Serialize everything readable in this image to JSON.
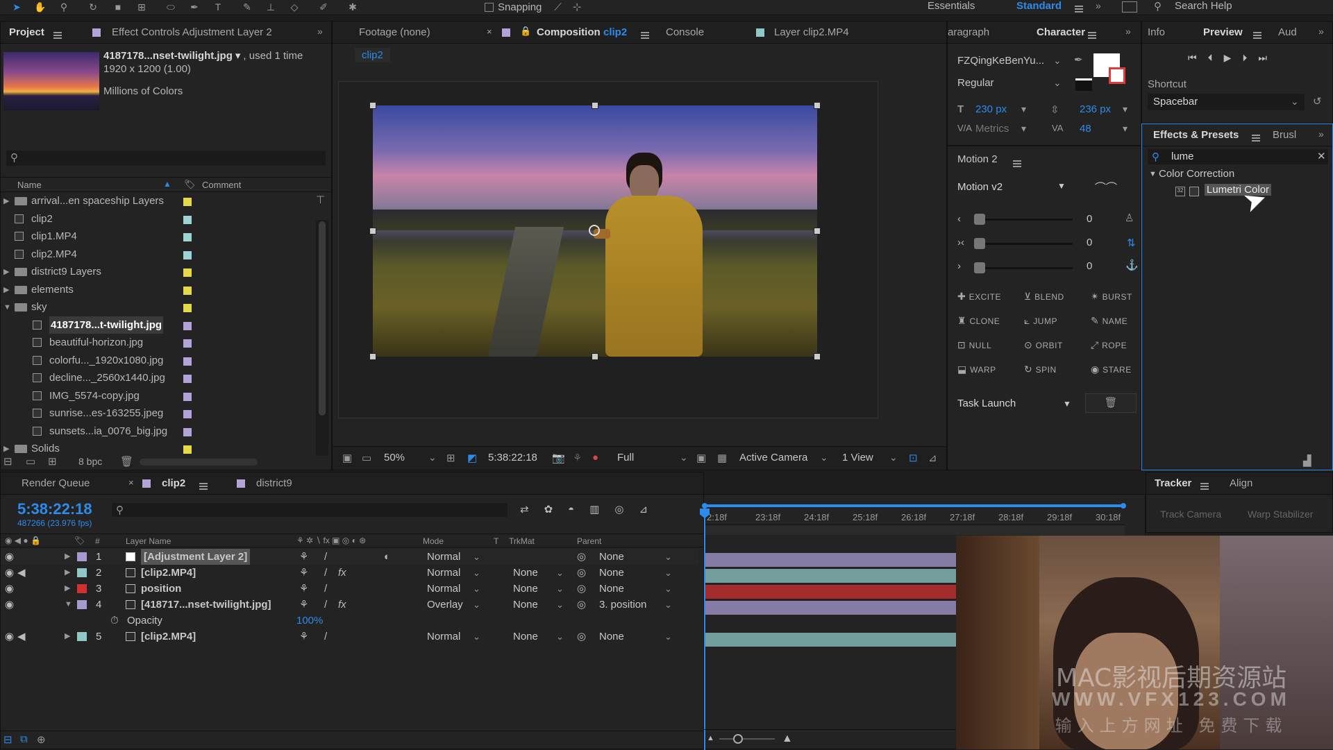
{
  "topbar": {
    "snapping": "Snapping",
    "workspaces": [
      "Essentials",
      "Standard"
    ],
    "search_placeholder": "Search Help"
  },
  "project": {
    "tab": "Project",
    "effect_controls_tab": "Effect Controls Adjustment Layer 2",
    "thumb_name": "4187178...nset-twilight.jpg",
    "used": ", used 1 time",
    "dims": "1920 x 1200 (1.00)",
    "colors": "Millions of Colors",
    "col_name": "Name",
    "col_comment": "Comment",
    "bpc": "8 bpc",
    "items": [
      {
        "name": "arrival...en spaceship Layers",
        "type": "folder",
        "indent": 0,
        "twirl": "▶",
        "color": "#e5d84a"
      },
      {
        "name": "clip2",
        "type": "comp",
        "indent": 0,
        "twirl": "",
        "color": "#9fd3d3"
      },
      {
        "name": "clip1.MP4",
        "type": "file",
        "indent": 0,
        "twirl": "",
        "color": "#9fd3d3"
      },
      {
        "name": "clip2.MP4",
        "type": "file",
        "indent": 0,
        "twirl": "",
        "color": "#9fd3d3"
      },
      {
        "name": "district9 Layers",
        "type": "folder",
        "indent": 0,
        "twirl": "▶",
        "color": "#e5d84a"
      },
      {
        "name": "elements",
        "type": "folder",
        "indent": 0,
        "twirl": "▶",
        "color": "#e5d84a"
      },
      {
        "name": "sky",
        "type": "folder",
        "indent": 0,
        "twirl": "▼",
        "color": "#e5d84a"
      },
      {
        "name": "4187178...t-twilight.jpg",
        "type": "file",
        "indent": 1,
        "twirl": "",
        "color": "#b3a3d8",
        "selected": true
      },
      {
        "name": "beautiful-horizon.jpg",
        "type": "file",
        "indent": 1,
        "twirl": "",
        "color": "#b3a3d8"
      },
      {
        "name": "colorfu..._1920x1080.jpg",
        "type": "file",
        "indent": 1,
        "twirl": "",
        "color": "#b3a3d8"
      },
      {
        "name": "decline..._2560x1440.jpg",
        "type": "file",
        "indent": 1,
        "twirl": "",
        "color": "#b3a3d8"
      },
      {
        "name": "IMG_5574-copy.jpg",
        "type": "file",
        "indent": 1,
        "twirl": "",
        "color": "#b3a3d8"
      },
      {
        "name": "sunrise...es-163255.jpeg",
        "type": "file",
        "indent": 1,
        "twirl": "",
        "color": "#b3a3d8"
      },
      {
        "name": "sunsets...ia_0076_big.jpg",
        "type": "file",
        "indent": 1,
        "twirl": "",
        "color": "#b3a3d8"
      },
      {
        "name": "Solids",
        "type": "folder",
        "indent": 0,
        "twirl": "▶",
        "color": "#e5d84a"
      }
    ]
  },
  "viewer": {
    "tabs": [
      "Footage (none)",
      "Composition",
      "clip2",
      "Console",
      "Layer clip2.MP4"
    ],
    "comp_chip": "clip2",
    "zoom": "50%",
    "timecode": "5:38:22:18",
    "resolution": "Full",
    "camera": "Active Camera",
    "views": "1 View"
  },
  "character": {
    "tabs": [
      "aragraph",
      "Character"
    ],
    "font": "FZQingKeBenYu...",
    "style": "Regular",
    "size": "230 px",
    "leading": "236 px",
    "kerning": "Metrics",
    "tracking": "48"
  },
  "motion": {
    "title": "Motion 2",
    "preset": "Motion v2",
    "sliders": [
      "0",
      "0",
      "0"
    ],
    "buttons": [
      "EXCITE",
      "BLEND",
      "BURST",
      "CLONE",
      "JUMP",
      "NAME",
      "NULL",
      "ORBIT",
      "ROPE",
      "WARP",
      "SPIN",
      "STARE"
    ],
    "task": "Task Launch"
  },
  "preview": {
    "tabs": [
      "Info",
      "Preview",
      "Aud"
    ],
    "shortcut_label": "Shortcut",
    "shortcut": "Spacebar"
  },
  "effects": {
    "tabs": [
      "Effects & Presets",
      "Brusl"
    ],
    "search": "lume",
    "category": "Color Correction",
    "item": "Lumetri Color"
  },
  "timeline": {
    "tabs": [
      "Render Queue",
      "clip2",
      "district9"
    ],
    "timecode": "5:38:22:18",
    "frames": "487266 (23.976 fps)",
    "cols": [
      "#",
      "Layer Name",
      "Mode",
      "T",
      "TrkMat",
      "Parent"
    ],
    "ruler": [
      "2:18f",
      "23:18f",
      "24:18f",
      "25:18f",
      "26:18f",
      "27:18f",
      "28:18f",
      "29:18f",
      "30:18f"
    ],
    "layers": [
      {
        "num": "1",
        "name": "[Adjustment Layer 2]",
        "label": "#a89ad0",
        "mode": "Normal",
        "trkmat": "",
        "parent": "None",
        "fx": false
      },
      {
        "num": "2",
        "name": "[clip2.MP4]",
        "label": "#8fc8c8",
        "mode": "Normal",
        "trkmat": "None",
        "parent": "None",
        "fx": true
      },
      {
        "num": "3",
        "name": "position",
        "label": "#d03030",
        "mode": "Normal",
        "trkmat": "None",
        "parent": "None",
        "fx": false
      },
      {
        "num": "4",
        "name": "[418717...nset-twilight.jpg]",
        "label": "#a89ad0",
        "mode": "Overlay",
        "trkmat": "None",
        "parent": "3. position",
        "fx": true
      },
      {
        "num": "5",
        "name": "[clip2.MP4]",
        "label": "#8fc8c8",
        "mode": "Normal",
        "trkmat": "None",
        "parent": "None",
        "fx": false
      }
    ],
    "opacity_label": "Opacity",
    "opacity_value": "100%"
  },
  "tracker": {
    "tabs": [
      "Tracker",
      "Align"
    ],
    "buttons": [
      "Track Camera",
      "Warp Stabilizer"
    ]
  },
  "watermark": {
    "line1": "MAC影视后期资源站",
    "line2": "WWW.VFX123.COM",
    "line3": "输入上方网址 免费下载"
  }
}
